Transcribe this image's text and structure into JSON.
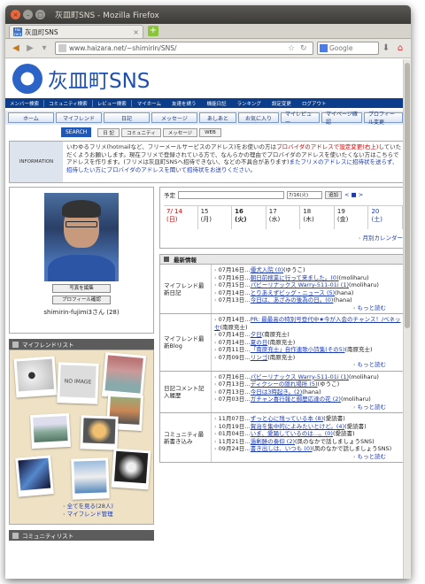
{
  "window": {
    "title": "灰皿町SNS - Mozilla Firefox"
  },
  "tab": {
    "label": "灰皿町SNS",
    "favicon": "Hai zara"
  },
  "nav": {
    "url": "www.haizara.net/~shimirin/SNS/",
    "search_placeholder": "Google"
  },
  "site": {
    "logo": "灰皿町SNS"
  },
  "menu1": [
    "メンバー検索",
    "コミュニティ検索",
    "レビュー検索",
    "マイホーム",
    "友達を誘う",
    "機能日記",
    "ランキング",
    "設定変更",
    "ログアウト"
  ],
  "menu2": [
    "ホーム",
    "マイフレンド",
    "日記",
    "メッセージ",
    "あしあと",
    "お気に入り",
    "マイレビュー",
    "マイページ確認",
    "プロフィール変更"
  ],
  "menu3": {
    "search": "SEARCH",
    "items": [
      "日 記",
      "コミュニティ",
      "メッセージ",
      "WEB"
    ]
  },
  "info": {
    "label": "INFORMATION",
    "line1": "いわゆるフリメ(hotmailなど、フリーメールサービスのアドレス)をお使いの方は",
    "red1": "プロバイダのアドレスで設定変更(右上)",
    "line2": "していただくようお願いします。現在フリメで登録されている方で、なんらかの理由でプロバイダのアドレスを使いたくない方はこちらでアドレスを作ります。(フリメは灰皿町SNSへ招待できない、などの不具合があります)",
    "blue1": "また",
    "line3": "フリメのアドレスに招待状を送らず、招待したい方にプロバイダのアドレスを聞いて招待状をお送りください。"
  },
  "profile": {
    "btn1": "写真を編集",
    "btn2": "プロフィール確認",
    "name": "shimirin-fujimi3さん (28)"
  },
  "friends": {
    "title": "マイフレンドリスト",
    "noimage": "NO IMAGE",
    "link1": "全てを見る(28人)",
    "link2": "マイフレンド管理"
  },
  "community": {
    "title": "コミュニティリスト"
  },
  "schedule": {
    "label": "予定",
    "date": "7/16(火)",
    "add": "追加",
    "nav": "< ■ >",
    "days": [
      {
        "d": "7/ 14",
        "w": "(日)"
      },
      {
        "d": "15",
        "w": "(月)"
      },
      {
        "d": "16",
        "w": "(火)"
      },
      {
        "d": "17",
        "w": "(水)"
      },
      {
        "d": "18",
        "w": "(木)"
      },
      {
        "d": "19",
        "w": "(金)"
      },
      {
        "d": "20",
        "w": "(土)"
      }
    ],
    "link": "月別カレンダー"
  },
  "news": {
    "title": "最新情報",
    "groups": [
      {
        "label": "マイフレンド最新日記",
        "items": [
          {
            "date": "07月16日…",
            "link": "優犬入院 (0)",
            "who": "(ゆうこ)"
          },
          {
            "date": "07月16日…",
            "link": "朝日前搜業に行って来ました。(0)",
            "who": "(moliharu)"
          },
          {
            "date": "07月15日…",
            "link": "パビーリナックス Warry-511-01i (1)",
            "who": "(moliharu)"
          },
          {
            "date": "07月14日…",
            "link": "とりあえずビッグ・ニュース (5)",
            "who": "(hana)"
          },
          {
            "date": "07月13日…",
            "link": "今日は、あざみの後為の日。(0)",
            "who": "(hana)"
          }
        ],
        "more": "もっと読む"
      },
      {
        "label": "マイフレンド最新Blog",
        "items": [
          {
            "date": "07月14日…",
            "link": "PR: 最最高の特別号登代中★今が入会のチャンス！/ベネッセ",
            "who": "(南原充士)"
          },
          {
            "date": "07月14日…",
            "link": "夕日",
            "who": "(南原充士)"
          },
          {
            "date": "07月14日…",
            "link": "夏の日",
            "who": "(南原充士)"
          },
          {
            "date": "07月11日…",
            "link": "「南原充士」自作連歌小詩集(その5)",
            "who": "(南原充士)"
          },
          {
            "date": "07月09日…",
            "link": "リンゴ",
            "who": "(南原充士)"
          }
        ],
        "more": "もっと読む"
      },
      {
        "label": "日記コメント記入履歴",
        "items": [
          {
            "date": "07月16日…",
            "link": "パビーリナックス Warry-511-01i (1)",
            "who": "(moliharu)"
          },
          {
            "date": "07月13日…",
            "link": "ディクシーの隠れ場所 (5)",
            "who": "(ゆうこ)"
          },
          {
            "date": "07月13日…",
            "link": "今日は3時起き。(2)",
            "who": "(hana)"
          },
          {
            "date": "07月03日…",
            "link": "ガチャン喜行報と御歴応達の花 (2)",
            "who": "(moliharu)"
          }
        ],
        "more": "もっと読む"
      },
      {
        "label": "コミュニティ最新書き込み",
        "items": [
          {
            "date": "11月07日…",
            "link": "ずっと心に残っている本 (8)",
            "who": "(愛読書)"
          },
          {
            "date": "10月19日…",
            "link": "賀治を集中的によみたいとけど。(4)",
            "who": "(愛読書)"
          },
          {
            "date": "01月04日…",
            "link": "いま、愛踊しているのは…。(0)",
            "who": "(愛読書)"
          },
          {
            "date": "11月21日…",
            "link": "過剰勝の奏仰 (2)",
            "who": "(凤のなかで話しましょうSNS)"
          },
          {
            "date": "09月24日…",
            "link": "書き出しは、いつも (0)",
            "who": "(凤のなかで話しましょうSNS)"
          }
        ],
        "more": "もっと読む"
      }
    ]
  }
}
